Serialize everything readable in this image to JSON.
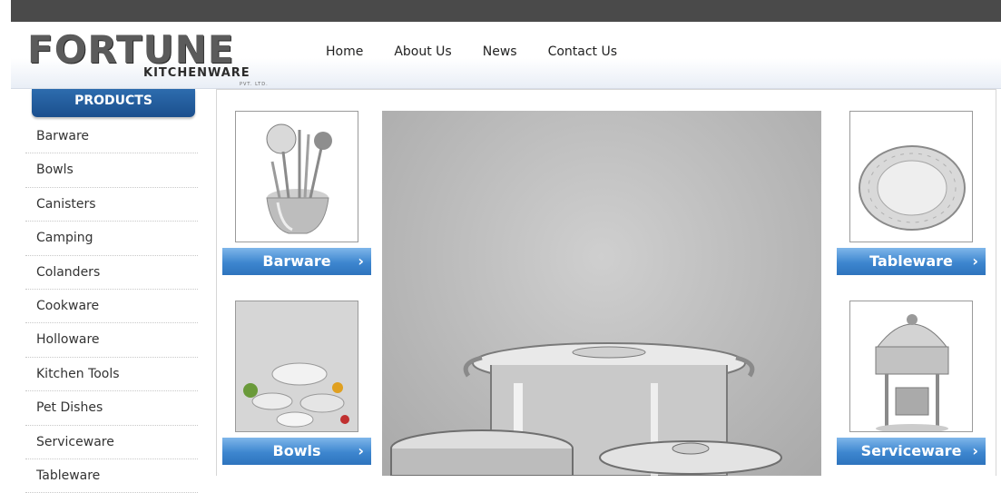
{
  "brand": {
    "logo_main": "FORTUNE",
    "logo_sub": "KITCHENWARE",
    "logo_pvt": "PVT. LTD."
  },
  "nav": {
    "items": [
      "Home",
      "About Us",
      "News",
      "Contact Us"
    ]
  },
  "sidebar": {
    "heading": "PRODUCTS",
    "items": [
      "Barware",
      "Bowls",
      "Canisters",
      "Camping",
      "Colanders",
      "Cookware",
      "Holloware",
      "Kitchen Tools",
      "Pet Dishes",
      "Serviceware",
      "Tableware"
    ]
  },
  "categories": {
    "barware": "Barware",
    "bowls": "Bowls",
    "tableware": "Tableware",
    "serviceware": "Serviceware",
    "arrow": "›"
  },
  "colors": {
    "accent_blue": "#2e74bd",
    "topbar": "#4a4a4a"
  }
}
